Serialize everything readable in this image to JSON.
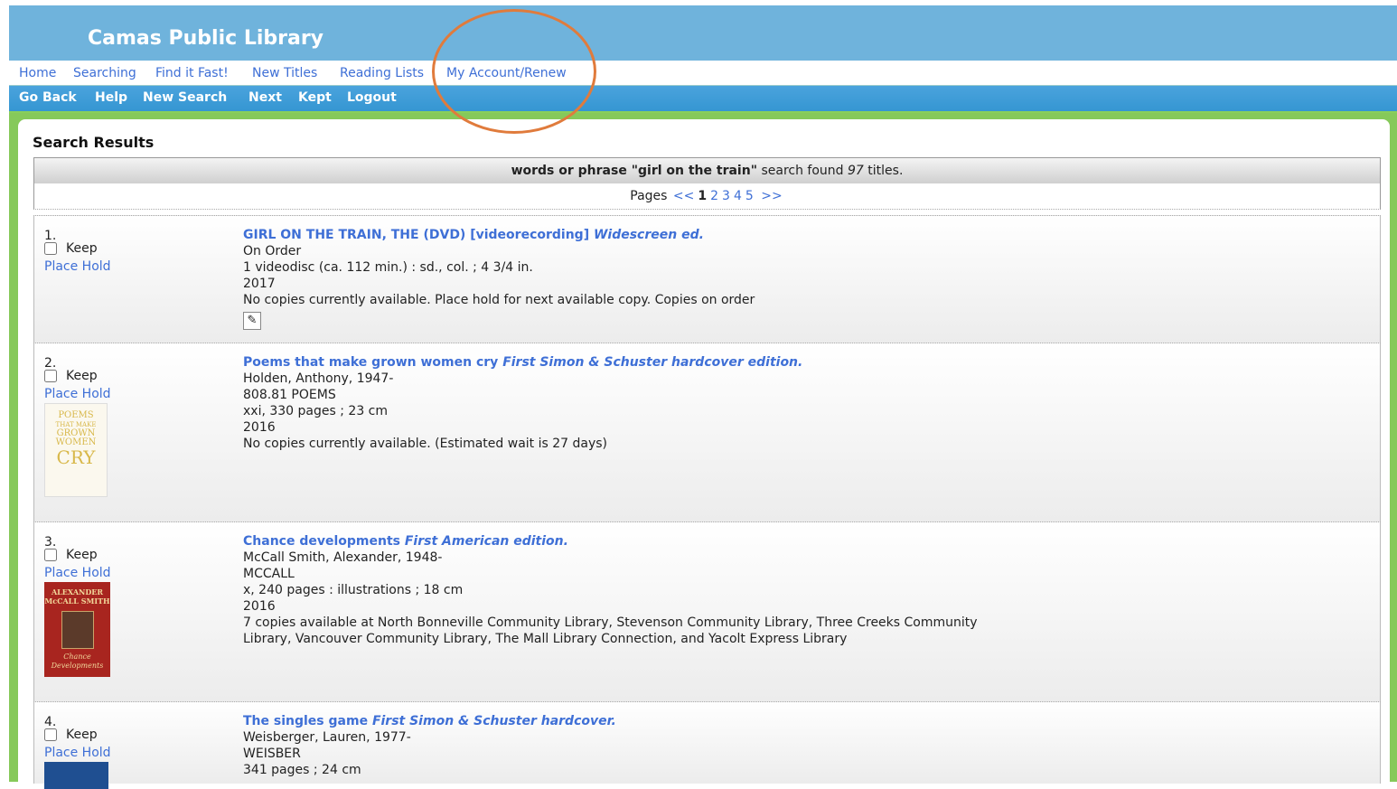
{
  "header": {
    "title": "Camas Public Library"
  },
  "topnav": [
    "Home",
    "Searching",
    "Find it Fast!",
    "New Titles",
    "Reading Lists",
    "My Account/Renew"
  ],
  "toolbar": [
    "Go Back",
    "Help",
    "New Search",
    "Next",
    "Kept",
    "Logout"
  ],
  "results": {
    "heading": "Search Results",
    "summary_prefix": "words or phrase",
    "query": "\"girl on the train\"",
    "summary_mid": "search found",
    "count": "97",
    "summary_suffix": "titles.",
    "pages_label": "Pages",
    "prev": "<<",
    "current_page": "1",
    "pages": [
      "2",
      "3",
      "4",
      "5"
    ],
    "next": ">>"
  },
  "labels": {
    "keep": "Keep",
    "place_hold": "Place Hold"
  },
  "records": [
    {
      "num": "1.",
      "title": "GIRL ON THE TRAIN, THE (DVD) [videorecording]",
      "edition": "Widescreen ed.",
      "line1": "On Order",
      "line2": "1 videodisc (ca. 112 min.) : sd., col. ; 4 3/4 in.",
      "line3": "2017",
      "line4": "No copies currently available. Place hold for next available copy. Copies on order"
    },
    {
      "num": "2.",
      "title": "Poems that make grown women cry",
      "edition": "First Simon & Schuster hardcover edition.",
      "line1": "Holden, Anthony, 1947-",
      "line2": "808.81 POEMS",
      "line3": "xxi, 330 pages ; 23 cm",
      "line4": "2016",
      "line5": "No copies currently available. (Estimated wait is 27 days)",
      "cover_text": [
        "POEMS",
        "THAT MAKE",
        "GROWN",
        "WOMEN",
        "CRY"
      ]
    },
    {
      "num": "3.",
      "title": "Chance developments",
      "edition": "First American edition.",
      "line1": "McCall Smith, Alexander, 1948-",
      "line2": "MCCALL",
      "line3": "x, 240 pages : illustrations ; 18 cm",
      "line4": "2016",
      "line5": "7 copies available at North Bonneville Community Library, Stevenson Community Library, Three Creeks Community",
      "line6": "Library, Vancouver Community Library, The Mall Library Connection, and Yacolt Express Library",
      "cover_text": [
        "ALEXANDER",
        "McCALL SMITH",
        "Chance",
        "Developments"
      ]
    },
    {
      "num": "4.",
      "title": "The singles game",
      "edition": "First Simon & Schuster hardcover.",
      "line1": "Weisberger, Lauren, 1977-",
      "line2": "WEISBER",
      "line3": "341 pages ; 24 cm"
    }
  ],
  "colors": {
    "header": "#6fb3dc",
    "link": "#3e6fd6",
    "toolbar": "#3596d2",
    "frame": "#86c95a",
    "highlight": "#e07b3c"
  }
}
